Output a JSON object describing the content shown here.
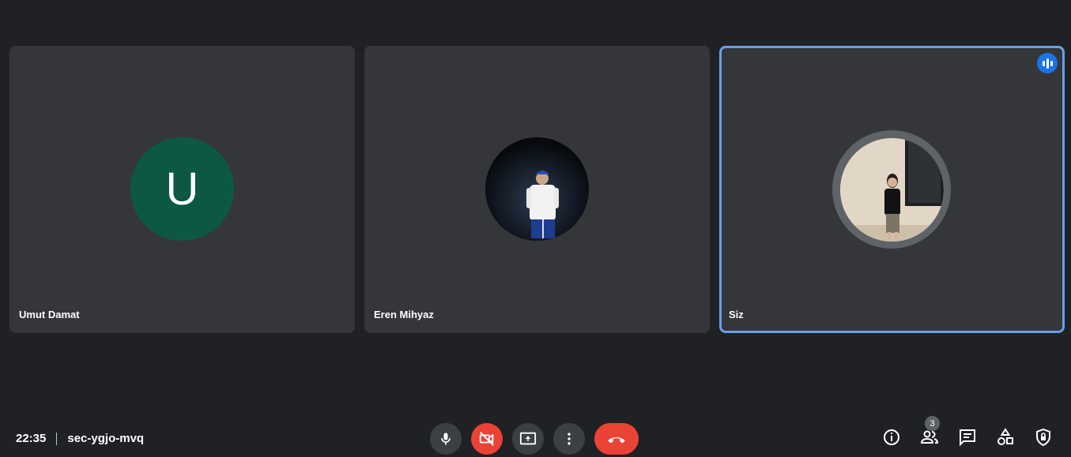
{
  "participants": [
    {
      "name": "Umut Damat",
      "avatar_letter": "U",
      "avatar_color": "#0d5845"
    },
    {
      "name": "Eren Mihyaz",
      "avatar": "profile-photo"
    },
    {
      "name": "Siz",
      "avatar": "profile-photo",
      "speaking": true
    }
  ],
  "meeting": {
    "time": "22:35",
    "code": "sec-ygjo-mvq"
  },
  "people_count": "3",
  "colors": {
    "background": "#202124",
    "tile": "#35363a",
    "active_border": "#6a9ee8",
    "danger": "#ea4335",
    "speaking": "#1a73e8"
  },
  "icons": {
    "controls": [
      "mic-icon",
      "camera-off-icon",
      "present-screen-icon",
      "more-options-icon",
      "hang-up-icon"
    ],
    "right": [
      "info-icon",
      "people-icon",
      "chat-icon",
      "activities-icon",
      "host-controls-icon"
    ]
  }
}
